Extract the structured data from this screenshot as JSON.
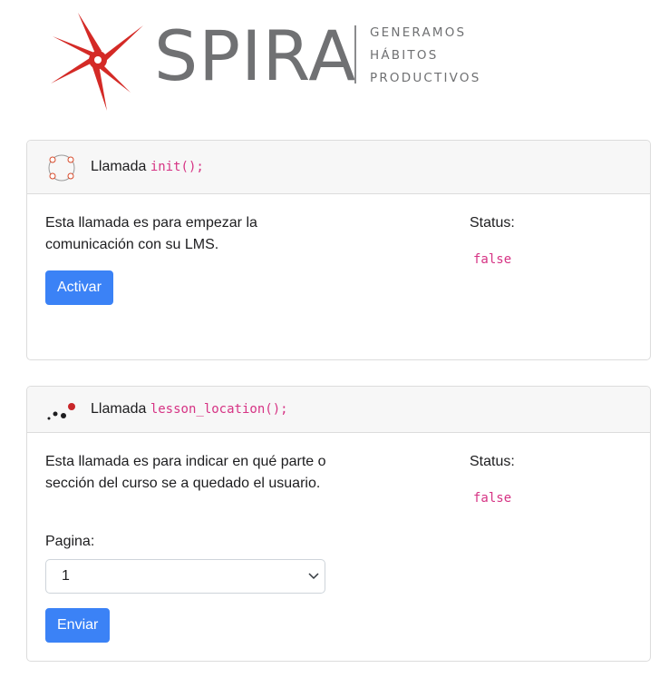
{
  "brand": {
    "name": "SPIRA",
    "tagline": [
      "GENERAMOS",
      "HÁBITOS",
      "PRODUCTIVOS"
    ],
    "colors": {
      "star": "#d42a26",
      "wordmark": "#707173"
    }
  },
  "cards": [
    {
      "title_prefix": "Llamada",
      "title_code": "init();",
      "icon": "circle-nodes-icon",
      "description": "Esta llamada es para empezar la comunicación con su LMS.",
      "status_label": "Status:",
      "status_value": "false",
      "button_label": "Activar"
    },
    {
      "title_prefix": "Llamada",
      "title_code": "lesson_location();",
      "icon": "dots-progress-icon",
      "description": "Esta llamada es para indicar en qué parte o sección del curso se a quedado el usuario.",
      "status_label": "Status:",
      "status_value": "false",
      "field_label": "Pagina:",
      "select_value": "1",
      "button_label": "Enviar"
    }
  ],
  "colors": {
    "primary_button": "#3b82f6",
    "code_text": "#d63384",
    "card_header_bg": "#f7f7f7"
  }
}
